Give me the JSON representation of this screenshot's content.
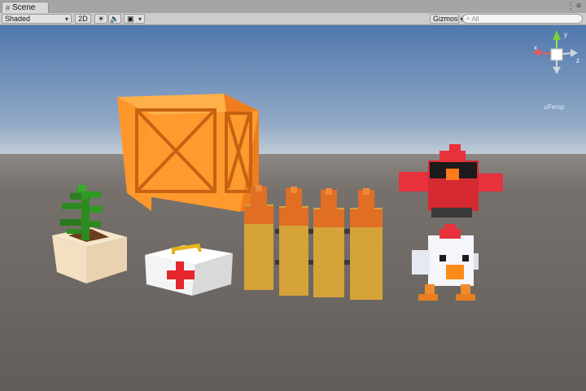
{
  "window": {
    "tab_title": "Scene"
  },
  "toolbar": {
    "shading_mode": "Shaded",
    "mode_2d": "2D",
    "gizmos_label": "Gizmos",
    "search_placeholder": "All"
  },
  "scene_gizmo": {
    "projection": "Persp",
    "axes": {
      "x": "x",
      "y": "y",
      "z": "z"
    }
  },
  "scene_objects": [
    "wooden-crate",
    "potted-plant",
    "first-aid-kit",
    "wooden-fence",
    "red-bird",
    "white-chicken"
  ],
  "colors": {
    "sky_top": "#5a7fb3",
    "sky_horizon": "#b6c4d2",
    "ground": "#6f6a66",
    "crate": "#ff9a2e",
    "fence_cap": "#e06e24",
    "fence_post": "#d6a338",
    "firstaid_cross": "#e5262c",
    "bird": "#e8313b",
    "chicken": "#f5f6fb"
  }
}
